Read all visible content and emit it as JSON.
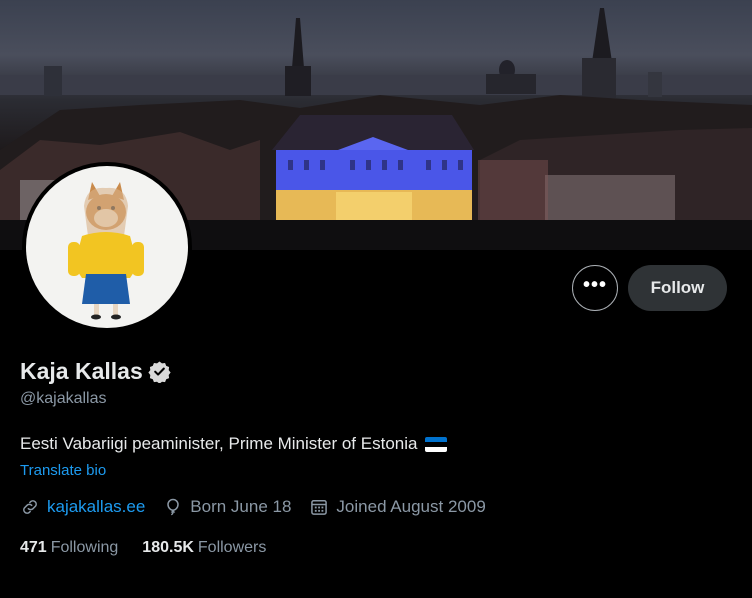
{
  "profile": {
    "name": "Kaja Kallas",
    "handle": "@kajakallas",
    "bio": "Eesti Vabariigi peaminister, Prime Minister of Estonia",
    "translate_label": "Translate bio",
    "website": "kajakallas.ee",
    "birthday": "Born June 18",
    "joined": "Joined August 2009",
    "following_count": "471",
    "following_label": "Following",
    "followers_count": "180.5K",
    "followers_label": "Followers"
  },
  "actions": {
    "more_label": "•••",
    "follow_label": "Follow"
  },
  "icons": {
    "verified": "verified-badge-icon",
    "link": "link-icon",
    "birthday": "balloon-icon",
    "calendar": "calendar-icon",
    "more": "more-icon"
  },
  "colors": {
    "accent": "#1d9bf0",
    "background": "#000000",
    "secondary_text": "#8b98a5",
    "follow_button": "#2f3336",
    "flag_blue": "#0072ce",
    "flag_black": "#000000",
    "flag_white": "#ffffff"
  }
}
